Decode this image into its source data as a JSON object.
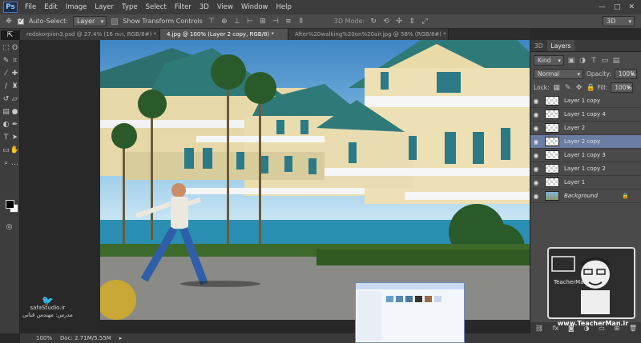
{
  "app": {
    "logo": "Ps"
  },
  "menu": [
    "File",
    "Edit",
    "Image",
    "Layer",
    "Type",
    "Select",
    "Filter",
    "3D",
    "View",
    "Window",
    "Help"
  ],
  "window_controls": [
    "—",
    "□",
    "✕"
  ],
  "options": {
    "auto_select_label": "Auto-Select:",
    "auto_select_value": "Layer",
    "transform_label": "Show Transform Controls",
    "mode_label": "3D Mode:",
    "workspace": "3D"
  },
  "tabs": [
    {
      "label": "redskorpion3.psd @ 27.4% (הות 16, RGB/8#) *",
      "active": false
    },
    {
      "label": "4.jpg @ 100% (Layer 2 copy, RGB/8) *",
      "active": true
    },
    {
      "label": "After%20walking%20on%20air.jpg @ 58% (RGB/8#) *",
      "active": false
    }
  ],
  "tool_icons": [
    "move-tool-icon",
    "marquee-tool-icon",
    "lasso-tool-icon",
    "quick-select-tool-icon",
    "crop-tool-icon",
    "eyedropper-tool-icon",
    "healing-tool-icon",
    "brush-tool-icon",
    "clone-stamp-tool-icon",
    "history-brush-tool-icon",
    "eraser-tool-icon",
    "gradient-tool-icon",
    "blur-tool-icon",
    "dodge-tool-icon",
    "pen-tool-icon",
    "type-tool-icon",
    "path-select-tool-icon",
    "shape-tool-icon",
    "hand-tool-icon",
    "zoom-tool-icon"
  ],
  "panel": {
    "tabs": [
      "3D",
      "Layers"
    ],
    "filter_label": "Kind",
    "blend_mode": "Normal",
    "opacity_label": "Opacity:",
    "opacity_value": "100%",
    "lock_label": "Lock:",
    "fill_label": "Fill:",
    "fill_value": "100%",
    "layers": [
      {
        "name": "Layer 1 copy",
        "selected": false,
        "background": false
      },
      {
        "name": "Layer 1 copy 4",
        "selected": false,
        "background": false
      },
      {
        "name": "Layer 2",
        "selected": false,
        "background": false
      },
      {
        "name": "Layer 2 copy",
        "selected": true,
        "background": false
      },
      {
        "name": "Layer 1 copy 3",
        "selected": false,
        "background": false
      },
      {
        "name": "Layer 1 copy 2",
        "selected": false,
        "background": false
      },
      {
        "name": "Layer 1",
        "selected": false,
        "background": false
      },
      {
        "name": "Background",
        "selected": false,
        "background": true
      }
    ]
  },
  "status": {
    "zoom": "100%",
    "doc": "Doc: 2.71M/5.55M"
  },
  "watermark": {
    "site": "safaStudio.ir",
    "line2": "مدرس: مهندس قناتی"
  },
  "teacher": {
    "url": "www.TeacherMan.ir",
    "brand": "TeacherMan"
  }
}
